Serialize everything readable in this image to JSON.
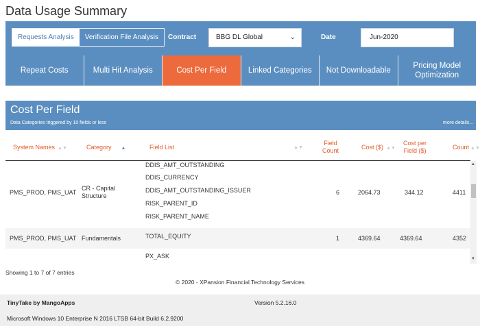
{
  "page": {
    "title": "Data Usage Summary"
  },
  "filters": {
    "view_toggle": [
      "Requests Analysis",
      "Verification File Analysis"
    ],
    "contract_label": "Contract",
    "contract_value": "BBG DL Global",
    "date_label": "Date",
    "date_value": "Jun-2020"
  },
  "tabs": [
    {
      "label": "Repeat Costs"
    },
    {
      "label": "Multi Hit Analysis"
    },
    {
      "label": "Cost Per Field"
    },
    {
      "label": "Linked Categories"
    },
    {
      "label": "Not Downloadable"
    },
    {
      "label": "Pricing Model Optimization"
    }
  ],
  "section": {
    "title": "Cost Per Field",
    "subtitle": "Data Categories triggered by 10 fields or less",
    "more_link": "more details..."
  },
  "table": {
    "columns": {
      "system_names": "System Names",
      "category": "Category",
      "field_list": "Field List",
      "field_count": "Field Count",
      "cost": "Cost ($)",
      "cost_per_field": "Cost per Field ($)",
      "count": "Count"
    },
    "rows": [
      {
        "system_names": "PMS_PROD, PMS_UAT",
        "category": "CR - Capital Structure",
        "fields": [
          "DDIS_AMT_OUTSTANDING",
          "DDIS_CURRENCY",
          "DDIS_AMT_OUTSTANDING_ISSUER",
          "RISK_PARENT_ID",
          "RISK_PARENT_NAME"
        ],
        "field_count": "6",
        "cost": "2064.73",
        "cost_per_field": "344.12",
        "count": "4411"
      },
      {
        "system_names": "PMS_PROD, PMS_UAT",
        "category": "Fundamentals",
        "fields": [
          "TOTAL_EQUITY"
        ],
        "field_count": "1",
        "cost": "4369.64",
        "cost_per_field": "4369.64",
        "count": "4352"
      },
      {
        "fields": [
          "PX_ASK"
        ]
      }
    ]
  },
  "pagination": {
    "info": "Showing 1 to 7 of 7 entries"
  },
  "footer": {
    "copyright": "© 2020 - XPansion Financial Technology Services"
  },
  "status_bar": {
    "app": "TinyTake by MangoApps",
    "version": "Version 5.2.16.0",
    "os": "Microsoft Windows 10 Enterprise N 2016 LTSB 64-bit Build 6.2.9200"
  },
  "colors": {
    "panel_blue": "#5b8ec0",
    "active_orange": "#ec6a3c",
    "header_orange": "#e05a2b"
  },
  "icons": {
    "select_chevron": "chevron-down-icon",
    "sort": "sort-icon",
    "scroll_up": "arrow-up-icon",
    "scroll_down": "arrow-down-icon"
  }
}
